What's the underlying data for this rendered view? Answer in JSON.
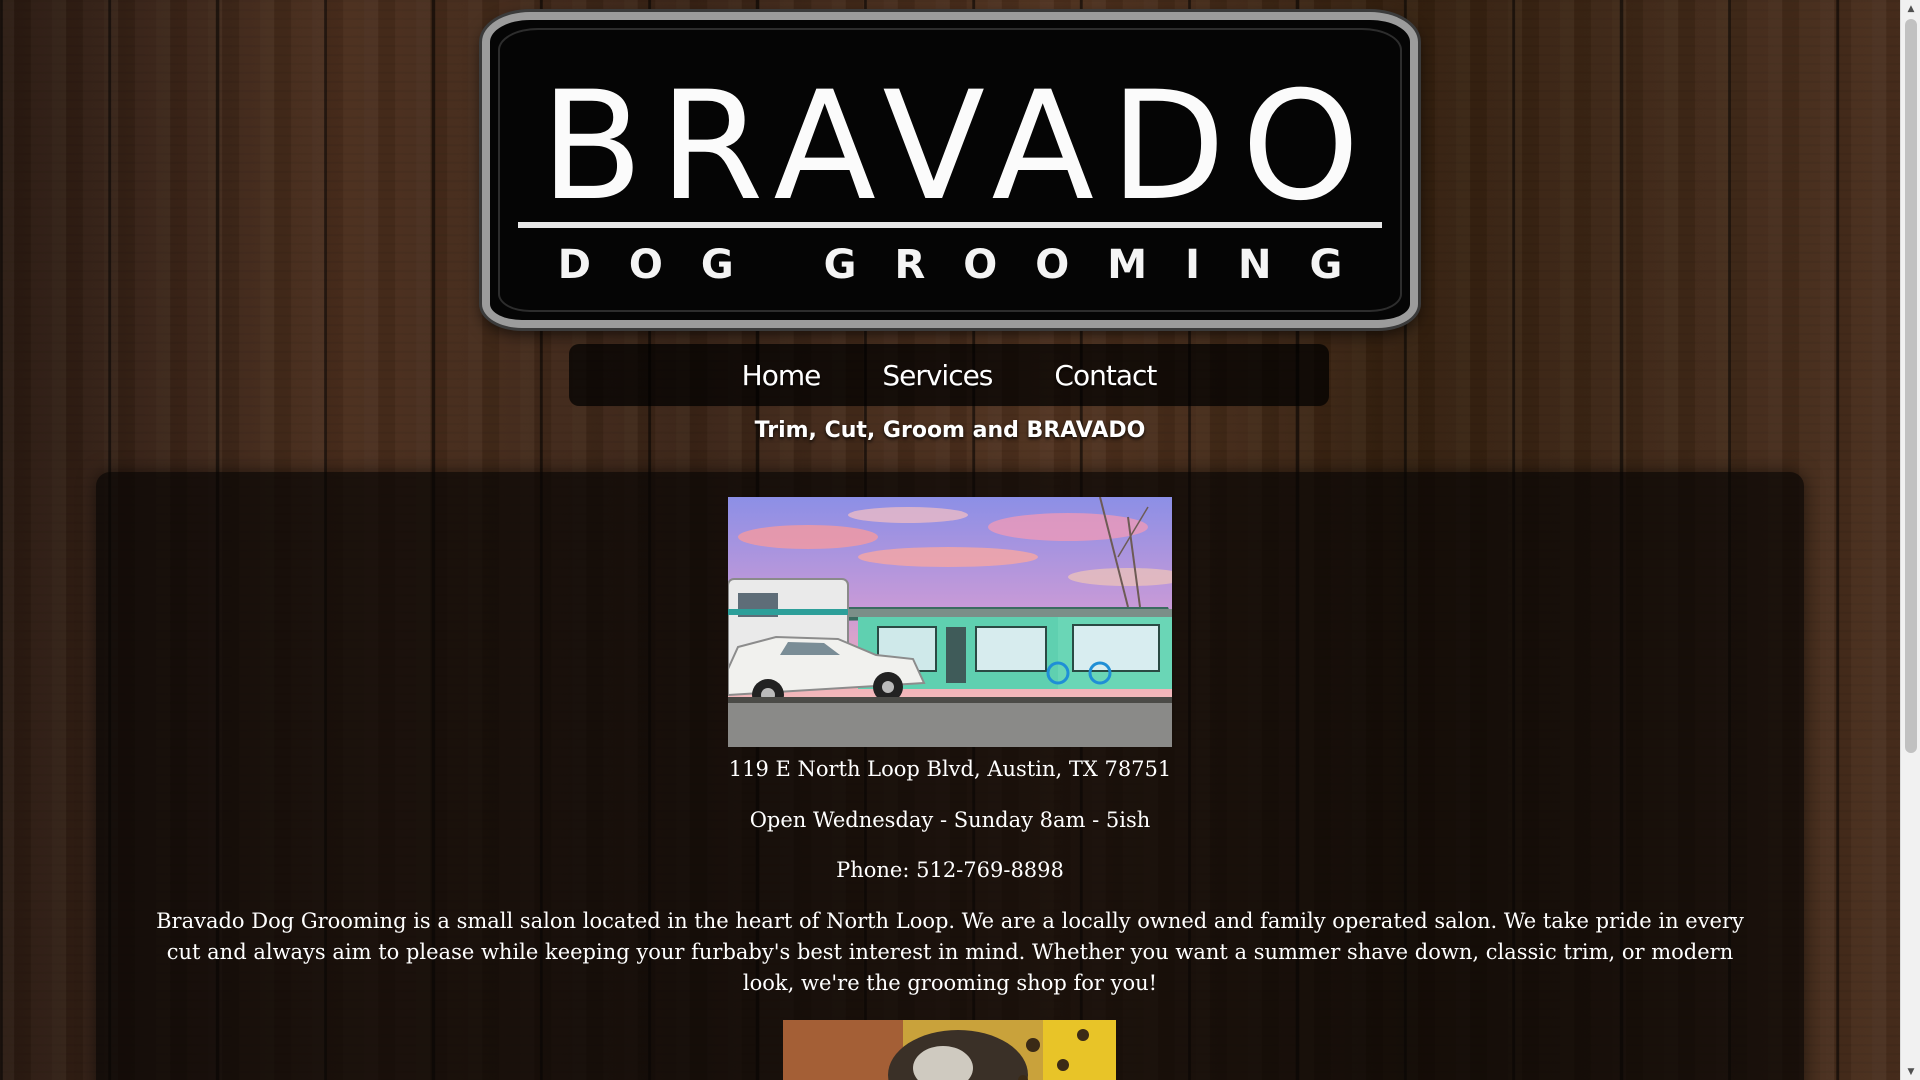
{
  "logo": {
    "title": "BRAVADO",
    "subtitle": "DOG GROOMING"
  },
  "nav": {
    "items": [
      {
        "label": "Home"
      },
      {
        "label": "Services"
      },
      {
        "label": "Contact"
      }
    ]
  },
  "tagline": "Trim, Cut, Groom and BRAVADO",
  "info": {
    "address": "119 E North Loop Blvd, Austin, TX 78751",
    "hours": "Open Wednesday - Sunday 8am - 5ish",
    "phone": "Phone: 512-769-8898"
  },
  "about": "Bravado Dog Grooming is a small salon located in the heart of North Loop. We are a locally owned and family operated salon. We take pride in every cut and always aim to please while keeping your furbaby's best interest in mind. Whether you want a summer shave down, classic trim, or modern look, we're the grooming shop for you!",
  "colors": {
    "wood": "#3a2418",
    "panel": "#0b0805",
    "nav_bg": "#0d0b0a",
    "storefront": "#5fd0b0",
    "text": "#ffffff"
  },
  "icons": {
    "scroll_up": "triangle-up-icon",
    "scroll_down": "triangle-down-icon"
  }
}
